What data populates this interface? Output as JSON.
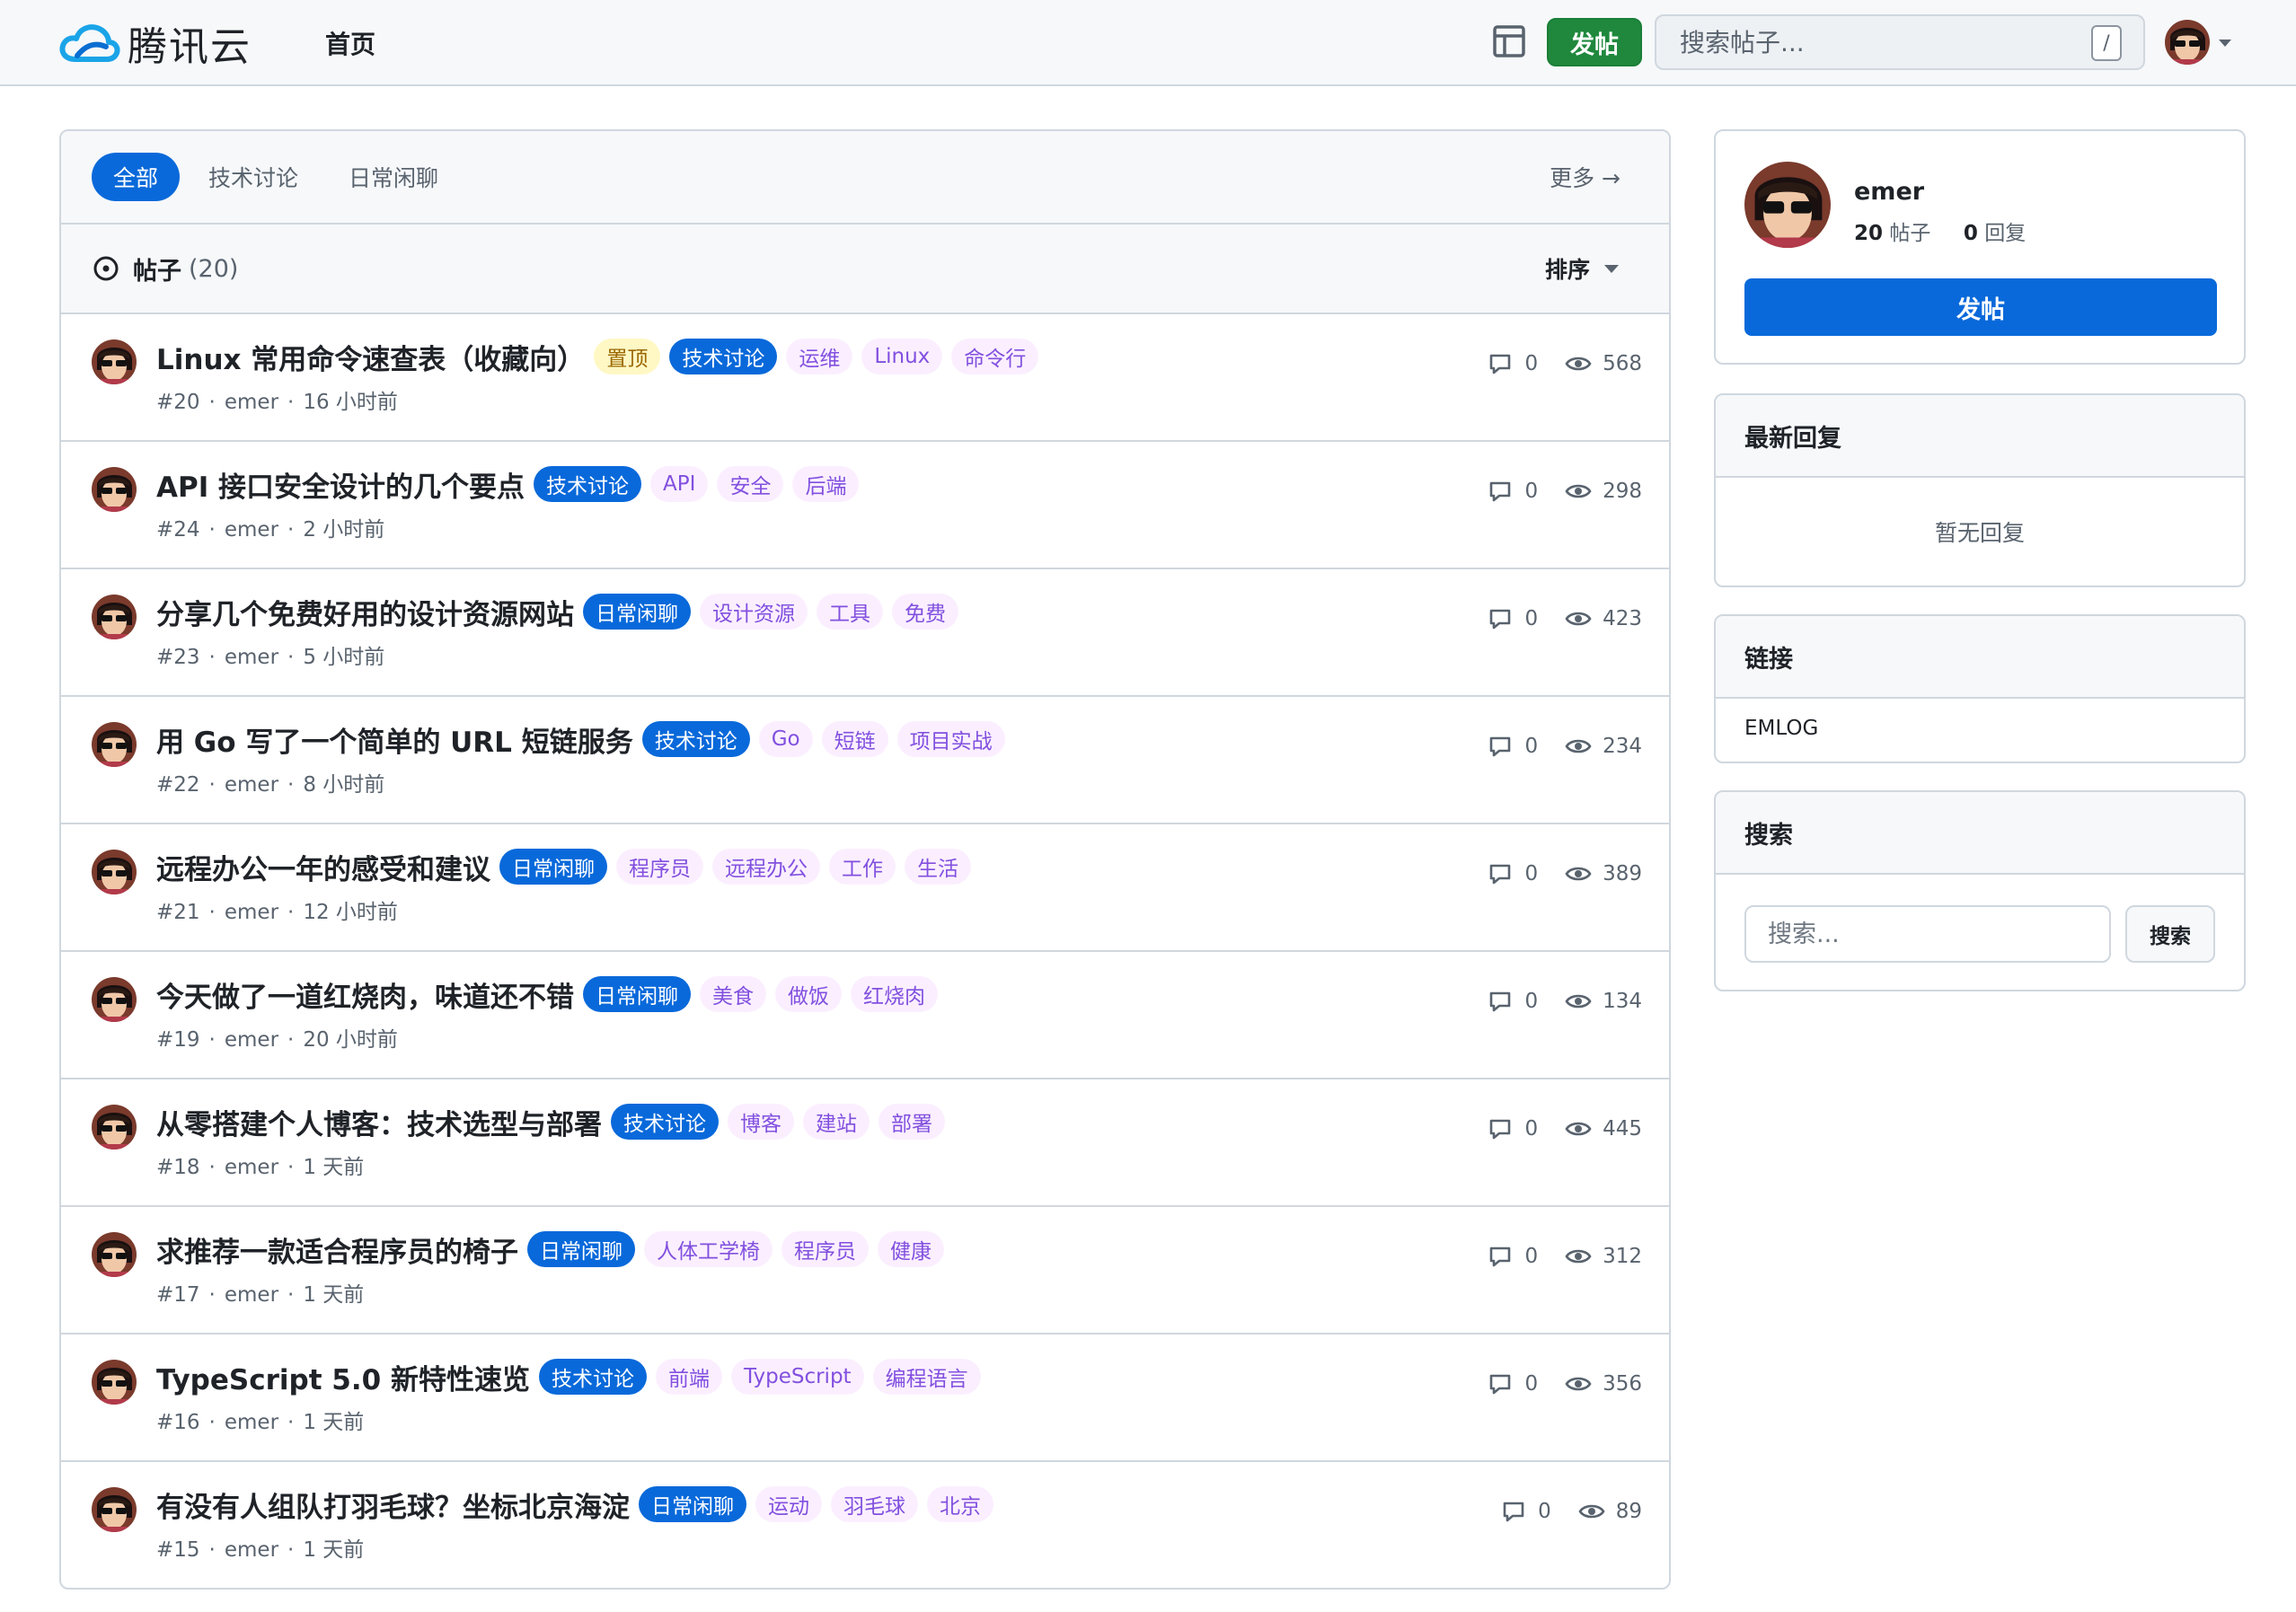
{
  "header": {
    "brand": "腾讯云",
    "nav_home": "首页",
    "post_button": "发帖",
    "search_placeholder": "搜索帖子...",
    "search_shortcut": "/"
  },
  "tabs": [
    {
      "label": "全部",
      "active": true
    },
    {
      "label": "技术讨论",
      "active": false
    },
    {
      "label": "日常闲聊",
      "active": false
    }
  ],
  "more_label": "更多 →",
  "list": {
    "title": "帖子",
    "count": "(20)",
    "sort_label": "排序"
  },
  "posts": [
    {
      "title": "Linux 常用命令速查表（收藏向）",
      "pinned": "置顶",
      "category": "技术讨论",
      "tags": [
        "运维",
        "Linux",
        "命令行"
      ],
      "id": "#20",
      "author": "emer",
      "time": "16 小时前",
      "comments": "0",
      "views": "568"
    },
    {
      "title": "API 接口安全设计的几个要点",
      "pinned": "",
      "category": "技术讨论",
      "tags": [
        "API",
        "安全",
        "后端"
      ],
      "id": "#24",
      "author": "emer",
      "time": "2 小时前",
      "comments": "0",
      "views": "298"
    },
    {
      "title": "分享几个免费好用的设计资源网站",
      "pinned": "",
      "category": "日常闲聊",
      "tags": [
        "设计资源",
        "工具",
        "免费"
      ],
      "id": "#23",
      "author": "emer",
      "time": "5 小时前",
      "comments": "0",
      "views": "423"
    },
    {
      "title": "用 Go 写了一个简单的 URL 短链服务",
      "pinned": "",
      "category": "技术讨论",
      "tags": [
        "Go",
        "短链",
        "项目实战"
      ],
      "id": "#22",
      "author": "emer",
      "time": "8 小时前",
      "comments": "0",
      "views": "234"
    },
    {
      "title": "远程办公一年的感受和建议",
      "pinned": "",
      "category": "日常闲聊",
      "tags": [
        "程序员",
        "远程办公",
        "工作",
        "生活"
      ],
      "id": "#21",
      "author": "emer",
      "time": "12 小时前",
      "comments": "0",
      "views": "389"
    },
    {
      "title": "今天做了一道红烧肉，味道还不错",
      "pinned": "",
      "category": "日常闲聊",
      "tags": [
        "美食",
        "做饭",
        "红烧肉"
      ],
      "id": "#19",
      "author": "emer",
      "time": "20 小时前",
      "comments": "0",
      "views": "134"
    },
    {
      "title": "从零搭建个人博客：技术选型与部署",
      "pinned": "",
      "category": "技术讨论",
      "tags": [
        "博客",
        "建站",
        "部署"
      ],
      "id": "#18",
      "author": "emer",
      "time": "1 天前",
      "comments": "0",
      "views": "445"
    },
    {
      "title": "求推荐一款适合程序员的椅子",
      "pinned": "",
      "category": "日常闲聊",
      "tags": [
        "人体工学椅",
        "程序员",
        "健康"
      ],
      "id": "#17",
      "author": "emer",
      "time": "1 天前",
      "comments": "0",
      "views": "312"
    },
    {
      "title": "TypeScript 5.0 新特性速览",
      "pinned": "",
      "category": "技术讨论",
      "tags": [
        "前端",
        "TypeScript",
        "编程语言"
      ],
      "id": "#16",
      "author": "emer",
      "time": "1 天前",
      "comments": "0",
      "views": "356"
    },
    {
      "title": "有没有人组队打羽毛球？坐标北京海淀",
      "pinned": "",
      "category": "日常闲聊",
      "tags": [
        "运动",
        "羽毛球",
        "北京"
      ],
      "id": "#15",
      "author": "emer",
      "time": "1 天前",
      "comments": "0",
      "views": "89"
    }
  ],
  "profile": {
    "name": "emer",
    "posts_count": "20",
    "posts_label": "帖子",
    "replies_count": "0",
    "replies_label": "回复",
    "post_button": "发帖"
  },
  "latest_replies": {
    "title": "最新回复",
    "empty": "暂无回复"
  },
  "links": {
    "title": "链接",
    "items": [
      "EMLOG"
    ]
  },
  "side_search": {
    "title": "搜索",
    "placeholder": "搜索...",
    "button": "搜索"
  },
  "colors": {
    "accent": "#0969da",
    "green": "#1f883d",
    "tag_bg": "#fbefff",
    "tag_fg": "#8250df",
    "pin_bg": "#fff8c5"
  }
}
